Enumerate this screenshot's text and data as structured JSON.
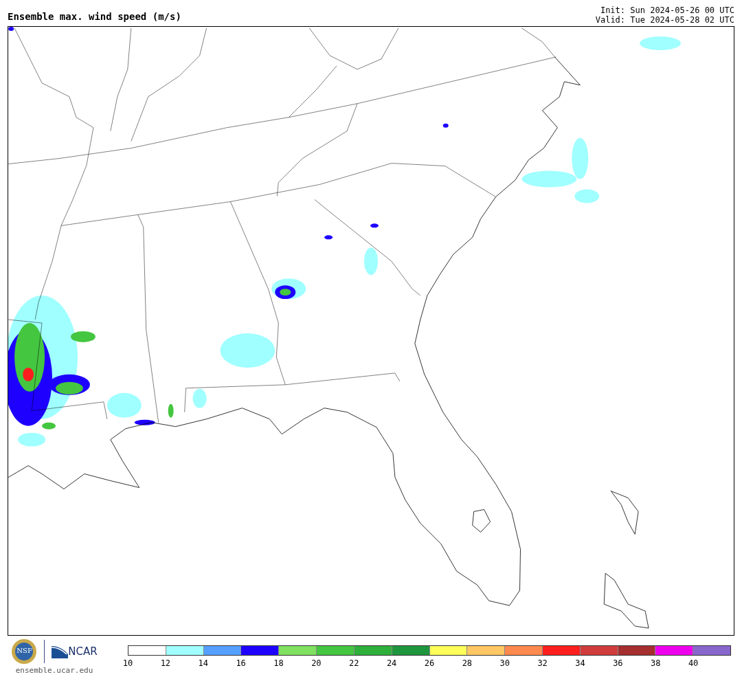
{
  "title": "Ensemble max. wind speed (m/s)",
  "init": "Init: Sun 2024-05-26 00 UTC",
  "valid": "Valid: Tue 2024-05-28 02 UTC",
  "logos": {
    "nsf": "NSF",
    "ncar": "NCAR",
    "url": "ensemble.ucar.edu"
  },
  "colorbar": {
    "bins": [
      {
        "color": "#ffffff"
      },
      {
        "color": "#a0ffff"
      },
      {
        "color": "#55a0ff"
      },
      {
        "color": "#1e00ff"
      },
      {
        "color": "#80e060"
      },
      {
        "color": "#44c640"
      },
      {
        "color": "#2eb03a"
      },
      {
        "color": "#1e963e"
      },
      {
        "color": "#ffff5a"
      },
      {
        "color": "#ffc864"
      },
      {
        "color": "#ff8a50"
      },
      {
        "color": "#ff1e1e"
      },
      {
        "color": "#d03c3c"
      },
      {
        "color": "#a52e2e"
      },
      {
        "color": "#ee00ee"
      },
      {
        "color": "#8866cc"
      }
    ],
    "ticks": [
      "10",
      "12",
      "14",
      "16",
      "18",
      "20",
      "22",
      "24",
      "26",
      "28",
      "30",
      "32",
      "34",
      "36",
      "38",
      "40"
    ]
  }
}
